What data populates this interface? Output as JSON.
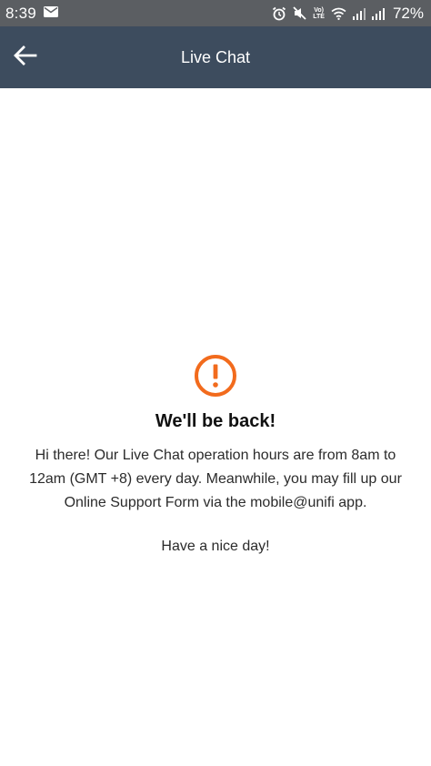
{
  "status_bar": {
    "time": "8:39",
    "battery_percent": "72%",
    "volte_line1": "Vo)",
    "volte_line2": "LTE",
    "icons": [
      "message-icon",
      "alarm-icon",
      "mute-icon",
      "wifi-icon",
      "signal-icon",
      "signal-icon-2"
    ]
  },
  "app_bar": {
    "title": "Live Chat",
    "back_icon": "arrow-left-icon",
    "background": "#3d4c5e"
  },
  "notice": {
    "icon": "alert-circle-icon",
    "icon_color": "#f26b1d",
    "title": "We'll be back!",
    "body": "Hi there! Our Live Chat operation hours are from 8am to 12am (GMT +8) every day. Meanwhile, you may fill up our Online Support Form via the mobile@unifi app.",
    "signoff": "Have a nice day!"
  }
}
